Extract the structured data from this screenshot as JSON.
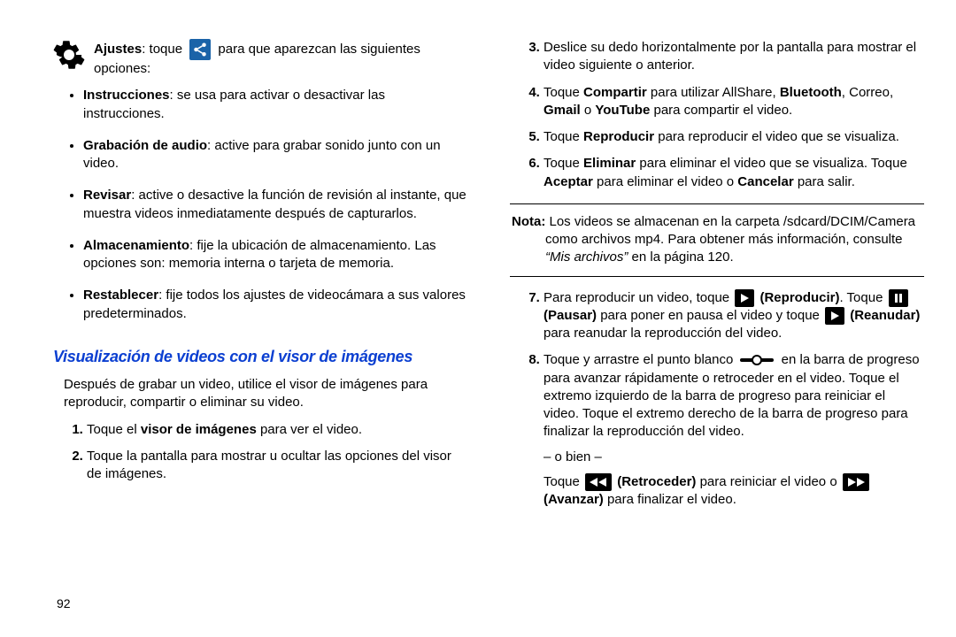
{
  "page_number": "92",
  "left": {
    "ajustes_label": "Ajustes",
    "ajustes_pre": ": toque",
    "ajustes_post": "para que aparezcan las siguientes opciones:",
    "bullets": [
      {
        "title": "Instrucciones",
        "text": ": se usa para activar o desactivar las instrucciones."
      },
      {
        "title": "Grabación de audio",
        "text": ": active para grabar sonido junto con un video."
      },
      {
        "title": "Revisar",
        "text": ": active o desactive la función de revisión al instante, que muestra videos inmediatamente después de capturarlos."
      },
      {
        "title": "Almacenamiento",
        "text": ": fije la ubicación de almacenamiento. Las opciones son: memoria interna o tarjeta de memoria."
      },
      {
        "title": "Restablecer",
        "text": ": fije todos los ajustes de videocámara a sus valores predeterminados."
      }
    ],
    "section_title": "Visualización de videos con el visor de imágenes",
    "intro": "Después de grabar un video, utilice el visor de imágenes para reproducir, compartir o eliminar su video.",
    "step1_a": "Toque el ",
    "step1_b": "visor de imágenes",
    "step1_c": " para ver el video.",
    "step2": "Toque la pantalla para mostrar u ocultar las opciones del visor de imágenes."
  },
  "right": {
    "step3": "Deslice su dedo horizontalmente por la pantalla para mostrar el video siguiente o anterior.",
    "step4_a": "Toque ",
    "step4_b": "Compartir",
    "step4_c": " para utilizar AllShare, ",
    "step4_d": "Bluetooth",
    "step4_e": ", Correo, ",
    "step4_f": "Gmail",
    "step4_g": " o ",
    "step4_h": "YouTube",
    "step4_i": " para compartir el video.",
    "step5_a": "Toque ",
    "step5_b": "Reproducir",
    "step5_c": " para reproducir el video que se visualiza.",
    "step6_a": "Toque ",
    "step6_b": "Eliminar",
    "step6_c": " para eliminar el video que se visualiza. Toque ",
    "step6_d": "Aceptar",
    "step6_e": " para eliminar el video o ",
    "step6_f": "Cancelar",
    "step6_g": " para salir.",
    "note_label": "Nota:",
    "note_text_a": " Los videos se almacenan en la carpeta /sdcard/DCIM/Camera como archivos mp4. Para obtener más información, consulte ",
    "note_text_b": "“Mis archivos”",
    "note_text_c": " en la página 120.",
    "step7_a": "Para reproducir un video, toque ",
    "step7_b": " (Reproducir)",
    "step7_c": ". Toque ",
    "step7_d": " (Pausar)",
    "step7_e": " para poner en pausa el video y toque ",
    "step7_f": " (Reanudar)",
    "step7_g": " para reanudar la reproducción del video.",
    "step8_a": "Toque y arrastre el punto blanco ",
    "step8_b": " en la barra de progreso para avanzar rápidamente o retroceder en el video. Toque el extremo izquierdo de la barra de progreso para reiniciar el video. Toque el extremo derecho de la barra de progreso para finalizar la reproducción del video.",
    "step8_or": "– o bien –",
    "step8_c": "Toque ",
    "step8_d": " (Retroceder)",
    "step8_e": " para reiniciar el video o ",
    "step8_f": " (Avanzar)",
    "step8_g": " para finalizar el video."
  }
}
